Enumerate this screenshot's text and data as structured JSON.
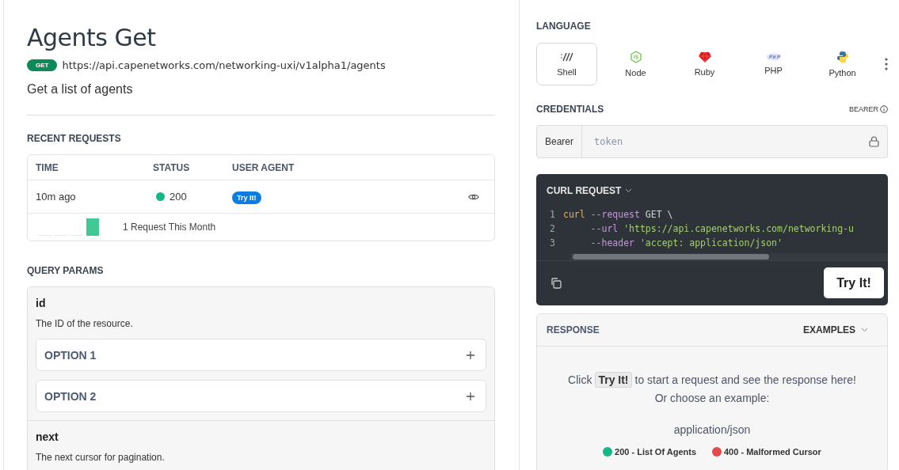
{
  "title": "Agents Get",
  "method": "GET",
  "url": "https://api.capenetworks.com/networking-uxi/v1alpha1/agents",
  "description": "Get a list of agents",
  "recent_requests": {
    "heading": "RECENT REQUESTS",
    "columns": [
      "TIME",
      "STATUS",
      "USER AGENT"
    ],
    "rows": [
      {
        "time": "10m ago",
        "status": "200",
        "color": "#12b886",
        "agent": "Try It!"
      }
    ],
    "summary": "1 Request This Month"
  },
  "query_params": {
    "heading": "QUERY PARAMS",
    "params": [
      {
        "name": "id",
        "description": "The ID of the resource.",
        "options": [
          {
            "label": "OPTION 1",
            "expanded": false
          },
          {
            "label": "OPTION 2",
            "expanded": false
          }
        ]
      },
      {
        "name": "next",
        "description": "The next cursor for pagination."
      }
    ]
  },
  "language": {
    "heading": "LANGUAGE",
    "items": [
      {
        "label": "Shell",
        "kind": "shell",
        "selected": true
      },
      {
        "label": "Node",
        "kind": "node",
        "selected": false
      },
      {
        "label": "Ruby",
        "kind": "ruby",
        "selected": false
      },
      {
        "label": "PHP",
        "kind": "php",
        "selected": false
      },
      {
        "label": "Python",
        "kind": "python",
        "selected": false
      }
    ]
  },
  "credentials": {
    "heading": "CREDENTIALS",
    "scheme": "BEARER",
    "prefix": "Bearer",
    "placeholder": "token"
  },
  "code": {
    "title": "CURL REQUEST",
    "lines": [
      {
        "number": "1",
        "tokens": [
          {
            "kind": "command",
            "text": "curl "
          },
          {
            "kind": "flag",
            "text": "--request"
          },
          {
            "kind": "plain",
            "text": " GET \\"
          }
        ]
      },
      {
        "number": "2",
        "tokens": [
          {
            "kind": "flag",
            "text": "     --url"
          },
          {
            "kind": "string",
            "text": " 'https://api.capenetworks.com/networking-u"
          }
        ]
      },
      {
        "number": "3",
        "tokens": [
          {
            "kind": "flag",
            "text": "     --header"
          },
          {
            "kind": "string",
            "text": " 'accept: application/json'"
          }
        ]
      }
    ],
    "button": "Try It!"
  },
  "response": {
    "heading": "RESPONSE",
    "examples_label": "EXAMPLES",
    "hint_before": "Click",
    "hint_chip": "Try It!",
    "hint_after": "to start a request and see the response here!",
    "hint_line2": "Or choose an example:",
    "content_type": "application/json",
    "examples": [
      {
        "label": "200 - List Of Agents",
        "color": "#12b886"
      },
      {
        "label": "400 - Malformed Cursor",
        "color": "#e5484d"
      }
    ]
  }
}
